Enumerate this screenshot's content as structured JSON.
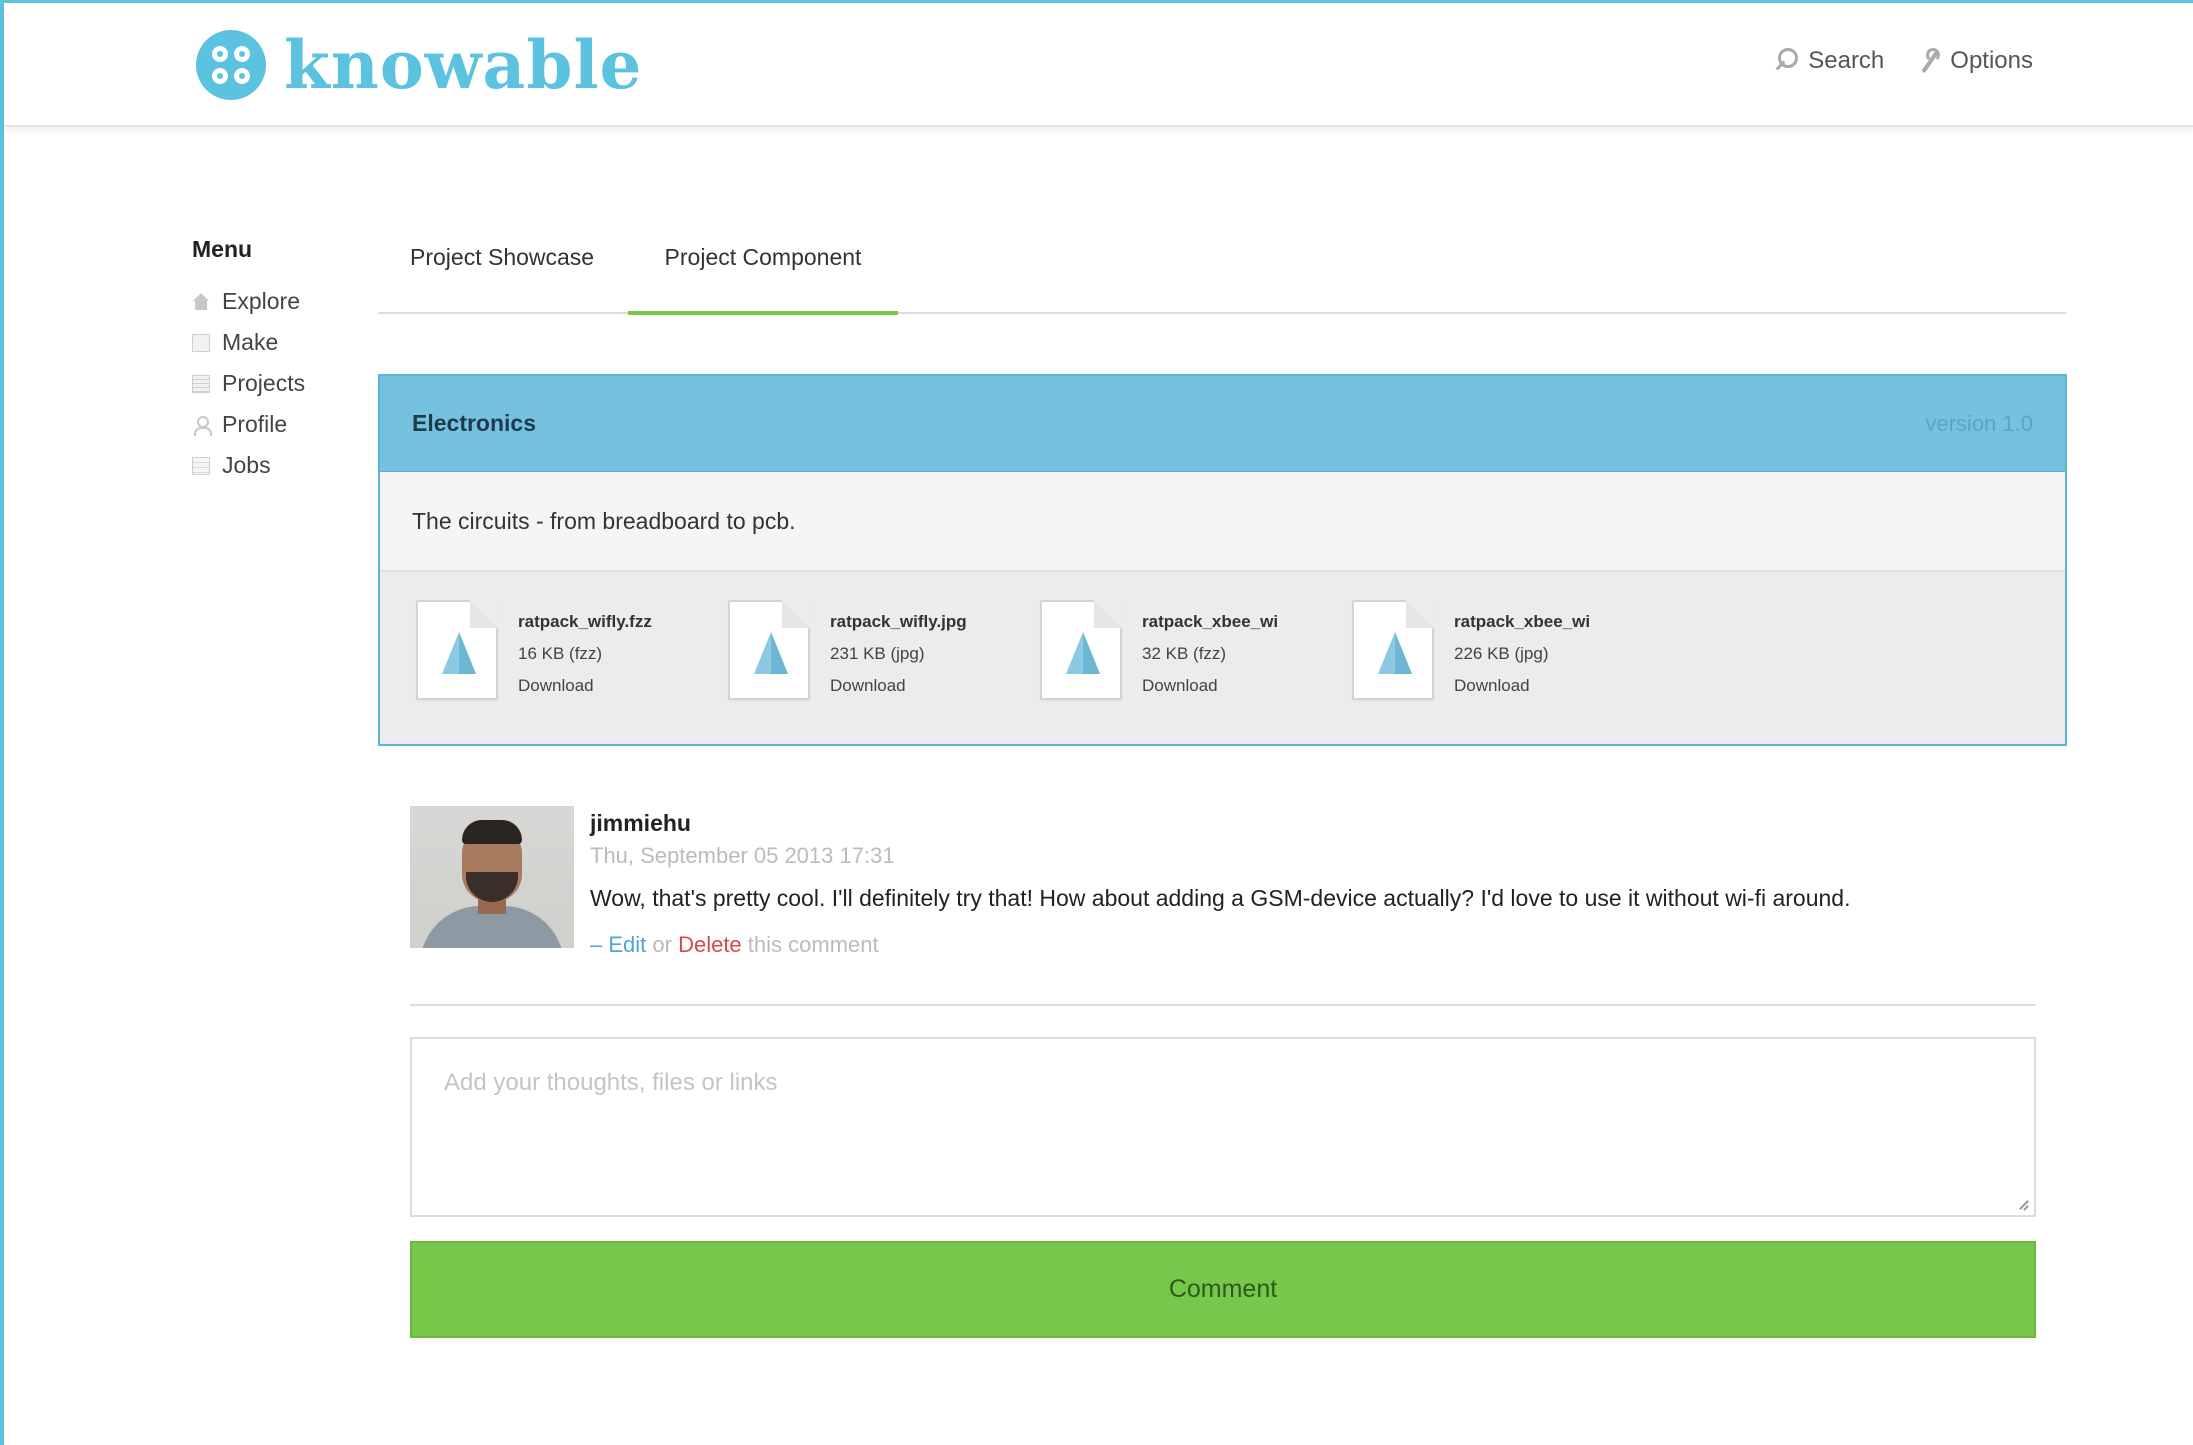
{
  "brand": {
    "name": "knowable",
    "accent": "#5bc3df"
  },
  "topnav": {
    "search_label": "Search",
    "options_label": "Options"
  },
  "sidebar": {
    "title": "Menu",
    "items": [
      {
        "label": "Explore",
        "icon": "home-icon"
      },
      {
        "label": "Make",
        "icon": "square-icon"
      },
      {
        "label": "Projects",
        "icon": "list-icon"
      },
      {
        "label": "Profile",
        "icon": "user-icon"
      },
      {
        "label": "Jobs",
        "icon": "document-icon"
      }
    ]
  },
  "tabs": [
    {
      "label": "Project Showcase",
      "active": false
    },
    {
      "label": "Project Component",
      "active": true
    }
  ],
  "component": {
    "title": "Electronics",
    "version": "version 1.0",
    "description": "The circuits - from breadboard to pcb.",
    "header_color": "#75c1e0",
    "files": [
      {
        "name": "ratpack_wifly.fzz",
        "size": "16 KB (fzz)",
        "action": "Download"
      },
      {
        "name": "ratpack_wifly.jpg",
        "size": "231 KB (jpg)",
        "action": "Download"
      },
      {
        "name": "ratpack_xbee_wi",
        "size": "32 KB (fzz)",
        "action": "Download"
      },
      {
        "name": "ratpack_xbee_wi",
        "size": "226 KB (jpg)",
        "action": "Download"
      }
    ]
  },
  "comment": {
    "user": "jimmiehu",
    "date": "Thu, September 05 2013 17:31",
    "text": "Wow, that's pretty cool. I'll definitely try that! How about adding a GSM-device actually? I'd love to use it without wi-fi around.",
    "actions": {
      "prefix": "– ",
      "edit": "Edit",
      "or": " or ",
      "delete": "Delete",
      "suffix": " this comment"
    }
  },
  "compose": {
    "placeholder": "Add your thoughts, files or links",
    "value": "",
    "submit_label": "Comment",
    "submit_color": "#76c74a"
  }
}
